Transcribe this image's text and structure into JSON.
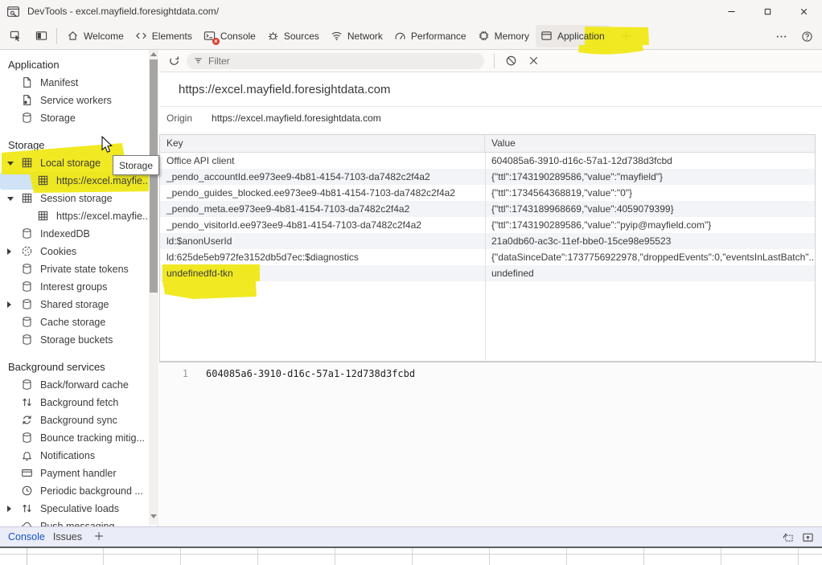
{
  "colors": {
    "marker": "#f0e70f",
    "accent_blue": "#1856c2",
    "selection_blue": "#cfe2f6"
  },
  "window": {
    "title": "DevTools - excel.mayfield.foresightdata.com/",
    "controls": [
      "minimize",
      "maximize",
      "close"
    ]
  },
  "tabbar": {
    "tools": [
      {
        "icon": "inspect"
      },
      {
        "icon": "device"
      }
    ],
    "tabs": [
      {
        "label": "Welcome",
        "icon": "home"
      },
      {
        "label": "Elements",
        "icon": "code"
      },
      {
        "label": "Console",
        "icon": "console",
        "badge": true
      },
      {
        "label": "Sources",
        "icon": "sources"
      },
      {
        "label": "Network",
        "icon": "network"
      },
      {
        "label": "Performance",
        "icon": "performance"
      },
      {
        "label": "Memory",
        "icon": "memory"
      },
      {
        "label": "Application",
        "icon": "application",
        "active": true,
        "highlighted": true
      }
    ],
    "overflow": [
      {
        "icon": "dots"
      },
      {
        "icon": "help"
      }
    ]
  },
  "sidebar": {
    "application": {
      "header": "Application",
      "items": [
        {
          "label": "Manifest",
          "icon": "manifest"
        },
        {
          "label": "Service workers",
          "icon": "service-worker"
        },
        {
          "label": "Storage",
          "icon": "database"
        }
      ]
    },
    "storage": {
      "header": "Storage",
      "items": [
        {
          "label": "Local storage",
          "icon": "grid",
          "expander": "open",
          "highlighted": true
        },
        {
          "label": "https://excel.mayfie...",
          "icon": "grid",
          "child": true,
          "selected": true
        },
        {
          "label": "Session storage",
          "icon": "grid",
          "expander": "open"
        },
        {
          "label": "https://excel.mayfie...",
          "icon": "grid",
          "child": true
        },
        {
          "label": "IndexedDB",
          "icon": "database"
        },
        {
          "label": "Cookies",
          "icon": "cookie",
          "expander": "closed"
        },
        {
          "label": "Private state tokens",
          "icon": "database"
        },
        {
          "label": "Interest groups",
          "icon": "database"
        },
        {
          "label": "Shared storage",
          "icon": "database",
          "expander": "closed"
        },
        {
          "label": "Cache storage",
          "icon": "database"
        },
        {
          "label": "Storage buckets",
          "icon": "database"
        }
      ]
    },
    "background": {
      "header": "Background services",
      "items": [
        {
          "label": "Back/forward cache",
          "icon": "database"
        },
        {
          "label": "Background fetch",
          "icon": "arrows-up-down"
        },
        {
          "label": "Background sync",
          "icon": "sync"
        },
        {
          "label": "Bounce tracking mitig...",
          "icon": "database"
        },
        {
          "label": "Notifications",
          "icon": "bell"
        },
        {
          "label": "Payment handler",
          "icon": "payment-card"
        },
        {
          "label": "Periodic background ...",
          "icon": "clock"
        },
        {
          "label": "Speculative loads",
          "icon": "arrows-up-down",
          "expander": "closed"
        },
        {
          "label": "Push messaging",
          "icon": "cloud"
        }
      ]
    },
    "tooltip": "Storage"
  },
  "main": {
    "toolbar": {
      "refresh_icon": "refresh",
      "filter_placeholder": "Filter",
      "buttons": [
        {
          "icon": "block"
        },
        {
          "icon": "close-x"
        }
      ]
    },
    "heading": "https://excel.mayfield.foresightdata.com",
    "origin_label": "Origin",
    "origin_value": "https://excel.mayfield.foresightdata.com",
    "table": {
      "columns": [
        "Key",
        "Value"
      ],
      "rows": [
        {
          "key": "Office API client",
          "value": "604085a6-3910-d16c-57a1-12d738d3fcbd"
        },
        {
          "key": "_pendo_accountId.ee973ee9-4b81-4154-7103-da7482c2f4a2",
          "value": "{\"ttl\":1743190289586,\"value\":\"mayfield\"}"
        },
        {
          "key": "_pendo_guides_blocked.ee973ee9-4b81-4154-7103-da7482c2f4a2",
          "value": "{\"ttl\":1734564368819,\"value\":\"0\"}"
        },
        {
          "key": "_pendo_meta.ee973ee9-4b81-4154-7103-da7482c2f4a2",
          "value": "{\"ttl\":1743189968669,\"value\":4059079399}"
        },
        {
          "key": "_pendo_visitorId.ee973ee9-4b81-4154-7103-da7482c2f4a2",
          "value": "{\"ttl\":1743190289586,\"value\":\"pyip@mayfield.com\"}"
        },
        {
          "key": "ld:$anonUserId",
          "value": "21a0db60-ac3c-11ef-bbe0-15ce98e95523"
        },
        {
          "key": "ld:625de5eb972fe3152db5d7ec:$diagnostics",
          "value": "{\"dataSinceDate\":1737756922978,\"droppedEvents\":0,\"eventsInLastBatch\"..."
        },
        {
          "key": "undefinedfd-tkn",
          "value": "undefined",
          "highlighted": true
        }
      ]
    },
    "preview": {
      "line_number": "1",
      "content": "604085a6-3910-d16c-57a1-12d738d3fcbd"
    }
  },
  "drawer": {
    "tabs": [
      {
        "label": "Console",
        "active": true
      },
      {
        "label": "Issues"
      }
    ],
    "right_icons": [
      {
        "icon": "dock"
      },
      {
        "icon": "panel-up"
      }
    ]
  }
}
